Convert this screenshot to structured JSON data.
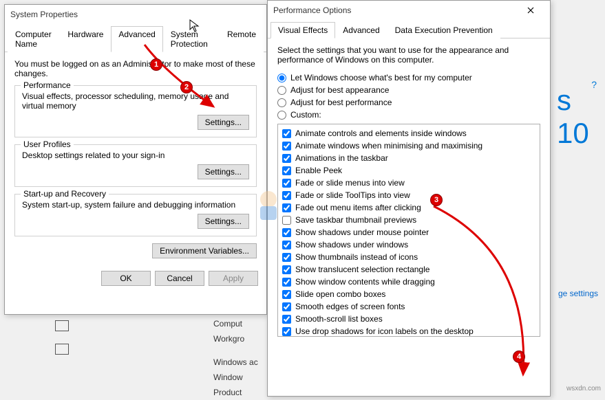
{
  "sysprops": {
    "title": "System Properties",
    "tabs": [
      "Computer Name",
      "Hardware",
      "Advanced",
      "System Protection",
      "Remote"
    ],
    "active_tab": 2,
    "admin_note": "You must be logged on as an Administrator to make most of these changes.",
    "perf": {
      "legend": "Performance",
      "desc": "Visual effects, processor scheduling, memory usage and virtual memory",
      "btn": "Settings..."
    },
    "profiles": {
      "legend": "User Profiles",
      "desc": "Desktop settings related to your sign-in",
      "btn": "Settings..."
    },
    "startup": {
      "legend": "Start-up and Recovery",
      "desc": "System start-up, system failure and debugging information",
      "btn": "Settings..."
    },
    "envvars_btn": "Environment Variables...",
    "ok": "OK",
    "cancel": "Cancel",
    "apply": "Apply"
  },
  "perfopts": {
    "title": "Performance Options",
    "tabs": [
      "Visual Effects",
      "Advanced",
      "Data Execution Prevention"
    ],
    "active_tab": 0,
    "intro": "Select the settings that you want to use for the appearance and performance of Windows on this computer.",
    "radios": [
      {
        "label": "Let Windows choose what's best for my computer",
        "checked": true
      },
      {
        "label": "Adjust for best appearance",
        "checked": false
      },
      {
        "label": "Adjust for best performance",
        "checked": false
      },
      {
        "label": "Custom:",
        "checked": false
      }
    ],
    "checks": [
      {
        "label": "Animate controls and elements inside windows",
        "checked": true
      },
      {
        "label": "Animate windows when minimising and maximising",
        "checked": true
      },
      {
        "label": "Animations in the taskbar",
        "checked": true
      },
      {
        "label": "Enable Peek",
        "checked": true
      },
      {
        "label": "Fade or slide menus into view",
        "checked": true
      },
      {
        "label": "Fade or slide ToolTips into view",
        "checked": true
      },
      {
        "label": "Fade out menu items after clicking",
        "checked": true
      },
      {
        "label": "Save taskbar thumbnail previews",
        "checked": false
      },
      {
        "label": "Show shadows under mouse pointer",
        "checked": true
      },
      {
        "label": "Show shadows under windows",
        "checked": true
      },
      {
        "label": "Show thumbnails instead of icons",
        "checked": true
      },
      {
        "label": "Show translucent selection rectangle",
        "checked": true
      },
      {
        "label": "Show window contents while dragging",
        "checked": true
      },
      {
        "label": "Slide open combo boxes",
        "checked": true
      },
      {
        "label": "Smooth edges of screen fonts",
        "checked": true
      },
      {
        "label": "Smooth-scroll list boxes",
        "checked": true
      },
      {
        "label": "Use drop shadows for icon labels on the desktop",
        "checked": true
      }
    ]
  },
  "bg": {
    "win10": "s 10",
    "link": "ge settings",
    "labels": {
      "comp": "Comput",
      "wg": "Workgro",
      "wact": "Windows ac",
      "wind": "Window",
      "prod": "Product"
    },
    "help": "?"
  },
  "steps": {
    "s1": "1",
    "s2": "2",
    "s3": "3",
    "s4": "4"
  },
  "watermark": "wsxdn.com"
}
